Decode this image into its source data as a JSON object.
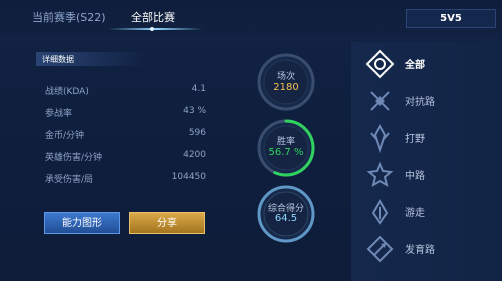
{
  "tabs": {
    "season": "当前赛季(S22)",
    "all_matches": "全部比赛"
  },
  "mode_select": {
    "value": "5V5"
  },
  "details": {
    "section_title": "详细数据",
    "rows": [
      {
        "label": "战绩(KDA)",
        "value": "4.1"
      },
      {
        "label": "参战率",
        "value": "43 %"
      },
      {
        "label": "金币/分钟",
        "value": "596"
      },
      {
        "label": "英雄伤害/分钟",
        "value": "4200"
      },
      {
        "label": "承受伤害/局",
        "value": "104450"
      }
    ]
  },
  "buttons": {
    "ability": "能力图形",
    "share": "分享"
  },
  "rings": {
    "matches": {
      "label": "场次",
      "value": "2180"
    },
    "winrate": {
      "label": "胜率",
      "value": "56.7 %",
      "fraction": 0.567
    },
    "score": {
      "label": "综合得分",
      "value": "64.5"
    }
  },
  "colors": {
    "gold": "#f5c351",
    "green": "#2fd25f",
    "cyan": "#8fd6ff"
  },
  "nav": {
    "items": [
      {
        "label": "全部",
        "icon": "all-roles-icon",
        "active": true
      },
      {
        "label": "对抗路",
        "icon": "clash-lane-icon",
        "active": false
      },
      {
        "label": "打野",
        "icon": "jungle-icon",
        "active": false
      },
      {
        "label": "中路",
        "icon": "mid-lane-icon",
        "active": false
      },
      {
        "label": "游走",
        "icon": "roam-icon",
        "active": false
      },
      {
        "label": "发育路",
        "icon": "farm-lane-icon",
        "active": false
      }
    ]
  }
}
